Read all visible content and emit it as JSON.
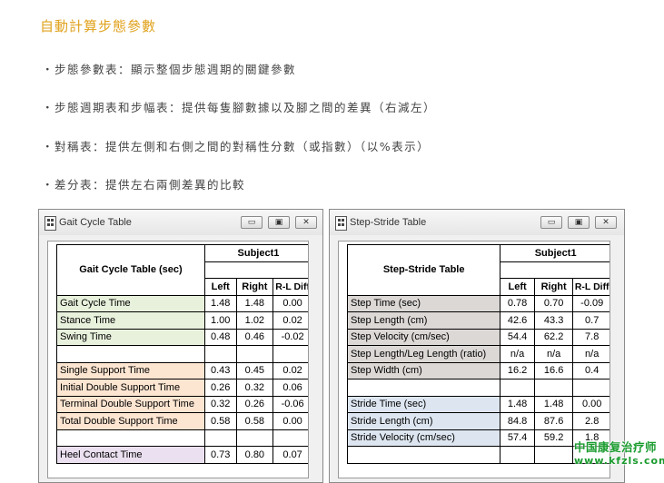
{
  "section_title": "自動計算步態參數",
  "bullets": [
    "・步態參數表：顯示整個步態週期的關鍵參數",
    "・步態週期表和步幅表：提供每隻腳數據以及腳之間的差異（右減左）",
    "・對稱表：提供左側和右側之間的對稱性分數（或指數）（以%表示）",
    "・差分表：提供左右兩側差異的比較"
  ],
  "gait_window": {
    "title": "Gait Cycle Table",
    "header": "Gait Cycle Table (sec)",
    "subject": "Subject1",
    "columns": [
      "Left",
      "Right",
      "R-L Diff"
    ],
    "rows": [
      {
        "label": "Gait Cycle Time",
        "values": [
          "1.48",
          "1.48",
          "0.00"
        ],
        "color": "#e8f1dc"
      },
      {
        "label": "Stance Time",
        "values": [
          "1.00",
          "1.02",
          "0.02"
        ],
        "color": "#e8f1dc"
      },
      {
        "label": "Swing Time",
        "values": [
          "0.48",
          "0.46",
          "-0.02"
        ],
        "color": "#e8f1dc"
      },
      {
        "label": "",
        "values": [
          "",
          "",
          ""
        ],
        "color": ""
      },
      {
        "label": "Single Support Time",
        "values": [
          "0.43",
          "0.45",
          "0.02"
        ],
        "color": "#fce5d1"
      },
      {
        "label": "Initial Double Support Time",
        "values": [
          "0.26",
          "0.32",
          "0.06"
        ],
        "color": "#fce5d1"
      },
      {
        "label": "Terminal Double Support Time",
        "values": [
          "0.32",
          "0.26",
          "-0.06"
        ],
        "color": "#fce5d1"
      },
      {
        "label": "Total Double Support Time",
        "values": [
          "0.58",
          "0.58",
          "0.00"
        ],
        "color": "#fce5d1"
      },
      {
        "label": "",
        "values": [
          "",
          "",
          ""
        ],
        "color": ""
      },
      {
        "label": "Heel Contact Time",
        "values": [
          "0.73",
          "0.80",
          "0.07"
        ],
        "color": "#ebe0ef"
      }
    ]
  },
  "stride_window": {
    "title": "Step-Stride Table",
    "header": "Step-Stride Table",
    "subject": "Subject1",
    "columns": [
      "Left",
      "Right",
      "R-L Diff"
    ],
    "rows": [
      {
        "label": "Step Time (sec)",
        "values": [
          "0.78",
          "0.70",
          "-0.09"
        ],
        "color": "#dcd8d6"
      },
      {
        "label": "Step Length (cm)",
        "values": [
          "42.6",
          "43.3",
          "0.7"
        ],
        "color": "#dcd8d6"
      },
      {
        "label": "Step Velocity (cm/sec)",
        "values": [
          "54.4",
          "62.2",
          "7.8"
        ],
        "color": "#dcd8d6"
      },
      {
        "label": "Step Length/Leg Length (ratio)",
        "values": [
          "n/a",
          "n/a",
          "n/a"
        ],
        "color": "#dcd8d6"
      },
      {
        "label": "Step Width (cm)",
        "values": [
          "16.2",
          "16.6",
          "0.4"
        ],
        "color": "#dcd8d6"
      },
      {
        "label": "",
        "values": [
          "",
          "",
          ""
        ],
        "color": ""
      },
      {
        "label": "Stride Time (sec)",
        "values": [
          "1.48",
          "1.48",
          "0.00"
        ],
        "color": "#dde6f0"
      },
      {
        "label": "Stride Length (cm)",
        "values": [
          "84.8",
          "87.6",
          "2.8"
        ],
        "color": "#dde6f0"
      },
      {
        "label": "Stride Velocity (cm/sec)",
        "values": [
          "57.4",
          "59.2",
          "1.8"
        ],
        "color": "#dde6f0"
      },
      {
        "label": "",
        "values": [
          "",
          "",
          ""
        ],
        "color": ""
      }
    ]
  },
  "window_buttons": {
    "minimize": "▭",
    "maximize": "▣",
    "close": "✕"
  },
  "watermark": {
    "line1": "中国康复治疗师",
    "line2": "www.kfzls.com"
  }
}
